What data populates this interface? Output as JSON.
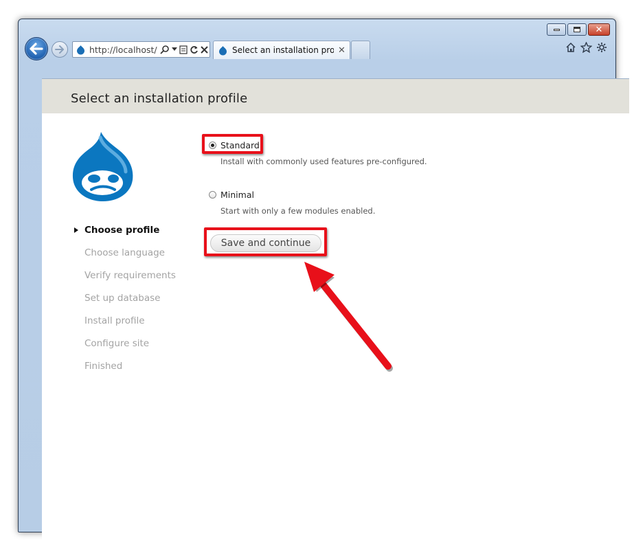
{
  "browser": {
    "address": "http://localhost/",
    "tab_title": "Select an installation profil...",
    "tab_close": "✕",
    "icons": [
      "back-arrow-icon",
      "forward-arrow-icon",
      "search-icon",
      "compat-icon",
      "refresh-icon",
      "stop-icon",
      "home-icon",
      "favorites-star-icon",
      "gear-icon"
    ]
  },
  "page": {
    "title": "Select an installation profile"
  },
  "steps": [
    {
      "label": "Choose profile",
      "active": true
    },
    {
      "label": "Choose language",
      "active": false
    },
    {
      "label": "Verify requirements",
      "active": false
    },
    {
      "label": "Set up database",
      "active": false
    },
    {
      "label": "Install profile",
      "active": false
    },
    {
      "label": "Configure site",
      "active": false
    },
    {
      "label": "Finished",
      "active": false
    }
  ],
  "profiles": {
    "standard": {
      "label": "Standard",
      "description": "Install with commonly used features pre-configured.",
      "selected": true
    },
    "minimal": {
      "label": "Minimal",
      "description": "Start with only a few modules enabled.",
      "selected": false
    }
  },
  "actions": {
    "save_label": "Save and continue"
  },
  "colors": {
    "highlight": "#e8101a",
    "header_band": "#e2e1da",
    "drupal_blue": "#0b77c0"
  }
}
